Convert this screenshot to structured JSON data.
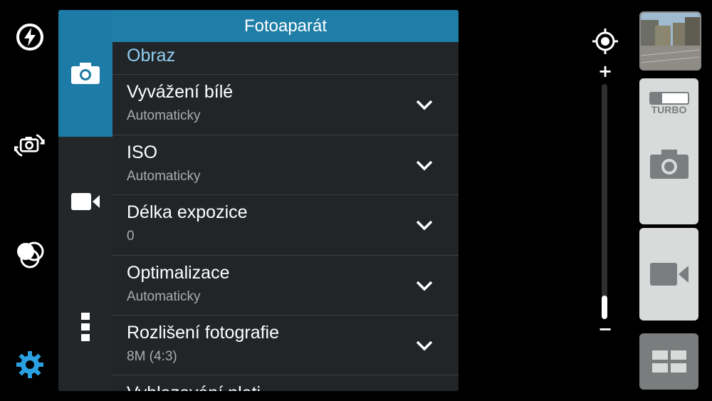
{
  "left_toolbar": {
    "icons": [
      "flash-auto-icon",
      "switch-camera-icon",
      "effects-icon",
      "settings-icon"
    ]
  },
  "panel": {
    "title": "Fotoaparát",
    "tabs": [
      "camera-tab-icon",
      "video-tab-icon",
      "more-tab-icon"
    ],
    "section_title": "Obraz",
    "rows": [
      {
        "label": "Vyvážení bílé",
        "value": "Automaticky"
      },
      {
        "label": "ISO",
        "value": "Automaticky"
      },
      {
        "label": "Délka expozice",
        "value": "0"
      },
      {
        "label": "Optimalizace",
        "value": "Automaticky"
      },
      {
        "label": "Rozlišení fotografie",
        "value": "8M (4:3)"
      }
    ],
    "partial_row_label": "Vyhlazování pleti..."
  },
  "right": {
    "turbo_label": "TURBO",
    "zoom_plus": "+",
    "zoom_minus": "−",
    "zoom_level": 0.1
  },
  "colors": {
    "accent": "#1f7ea7",
    "section": "#8fd0f4",
    "settings_icon": "#2aa0e0"
  }
}
